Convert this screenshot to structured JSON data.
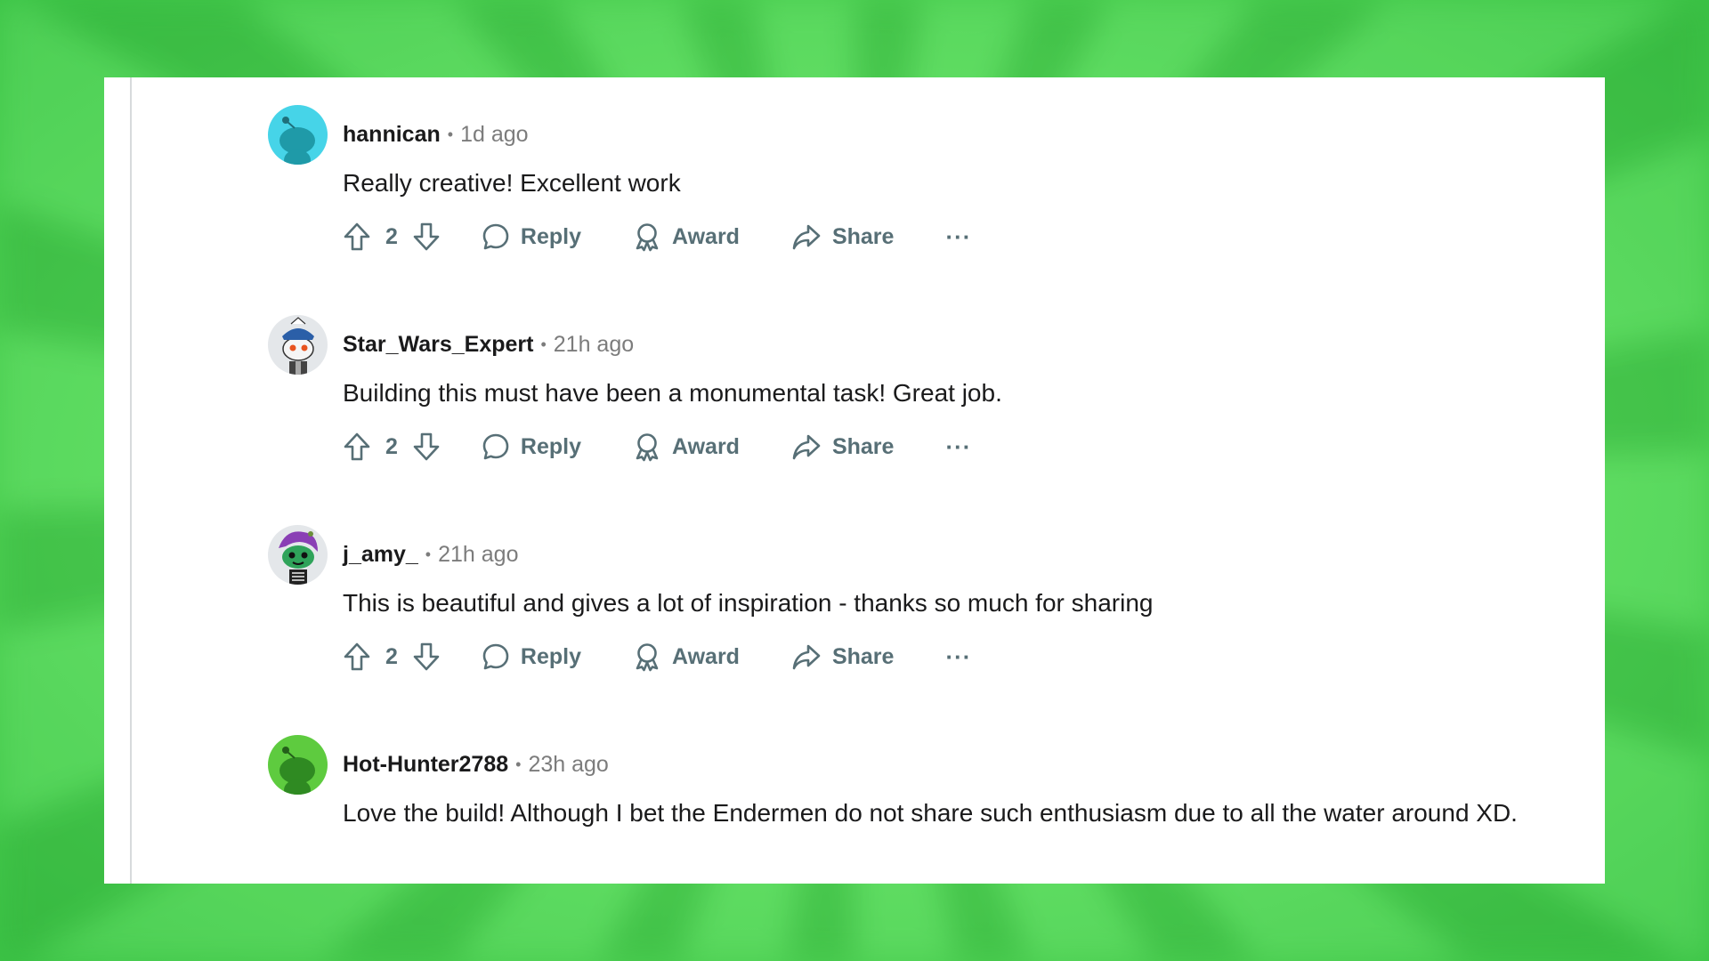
{
  "comments": [
    {
      "username": "hannican",
      "separator": "•",
      "time": "1d ago",
      "text": "Really creative! Excellent work",
      "votes": "2",
      "avatar": {
        "icon": "snoo-avatar-teal",
        "color": "#46d4e8"
      }
    },
    {
      "username": "Star_Wars_Expert",
      "separator": "•",
      "time": "21h ago",
      "text": "Building this must have been a monumental task! Great job.",
      "votes": "2",
      "avatar": {
        "icon": "snoo-avatar-captain",
        "color": "#e4e7ea"
      }
    },
    {
      "username": "j_amy_",
      "separator": "•",
      "time": "21h ago",
      "text": "This is beautiful and gives a lot of inspiration - thanks so much for sharing",
      "votes": "2",
      "avatar": {
        "icon": "snoo-avatar-green-purple-hair",
        "color": "#e4e7ea"
      }
    },
    {
      "username": "Hot-Hunter2788",
      "separator": "•",
      "time": "23h ago",
      "text": "Love the build! Although I bet the Endermen do not share such enthusiasm due to all the water around XD.",
      "avatar": {
        "icon": "snoo-avatar-green",
        "color": "#5ecb3f"
      }
    }
  ],
  "actions": {
    "reply": "Reply",
    "award": "Award",
    "share": "Share",
    "more": "···"
  }
}
